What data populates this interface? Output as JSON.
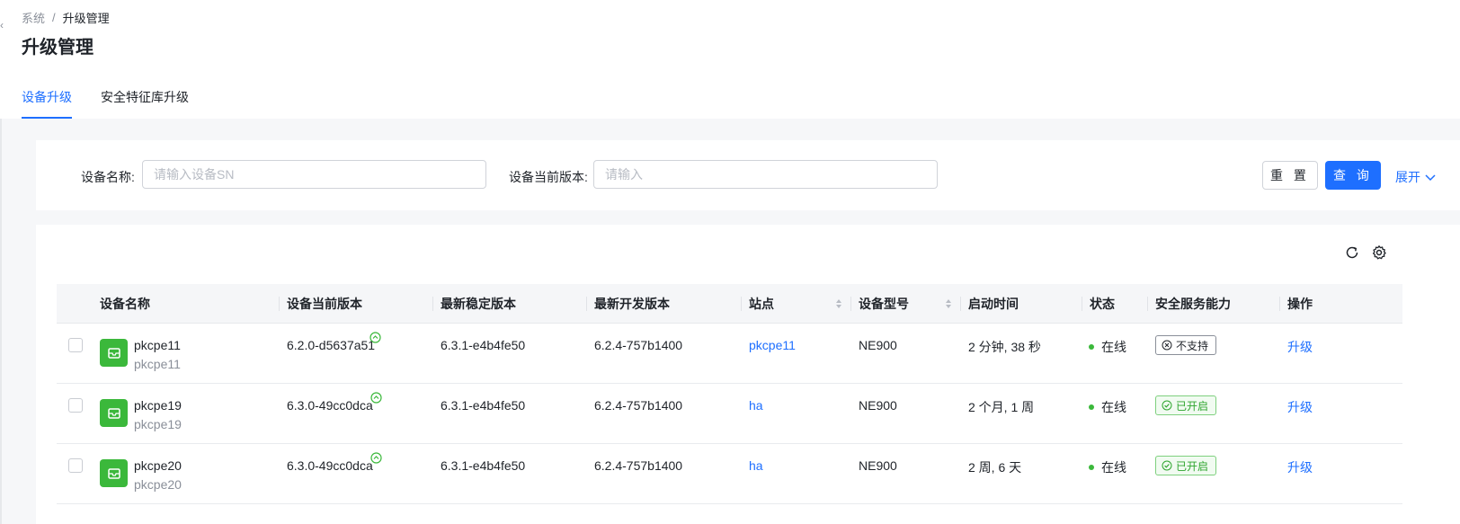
{
  "breadcrumb": {
    "root": "系统",
    "separator": "/",
    "current": "升级管理"
  },
  "page_title": "升级管理",
  "tabs": [
    {
      "label": "设备升级",
      "active": true
    },
    {
      "label": "安全特征库升级",
      "active": false
    }
  ],
  "search": {
    "device_name_label": "设备名称:",
    "device_name_placeholder": "请输入设备SN",
    "version_label": "设备当前版本:",
    "version_placeholder": "请输入",
    "reset_label": "重 置",
    "query_label": "查 询",
    "expand_label": "展开"
  },
  "table": {
    "columns": [
      "设备名称",
      "设备当前版本",
      "最新稳定版本",
      "最新开发版本",
      "站点",
      "设备型号",
      "启动时间",
      "状态",
      "安全服务能力",
      "操作"
    ],
    "rows": [
      {
        "name": "pkcpe11",
        "sub": "pkcpe11",
        "current_version": "6.2.0-d5637a51",
        "stable_version": "6.3.1-e4b4fe50",
        "dev_version": "6.2.4-757b1400",
        "site": "pkcpe11",
        "model": "NE900",
        "uptime": "2 分钟, 38 秒",
        "status": "在线",
        "security": "不支持",
        "action": "升级"
      },
      {
        "name": "pkcpe19",
        "sub": "pkcpe19",
        "current_version": "6.3.0-49cc0dca",
        "stable_version": "6.3.1-e4b4fe50",
        "dev_version": "6.2.4-757b1400",
        "site": "ha",
        "model": "NE900",
        "uptime": "2 个月, 1 周",
        "status": "在线",
        "security": "已开启",
        "action": "升级"
      },
      {
        "name": "pkcpe20",
        "sub": "pkcpe20",
        "current_version": "6.3.0-49cc0dca",
        "stable_version": "6.3.1-e4b4fe50",
        "dev_version": "6.2.4-757b1400",
        "site": "ha",
        "model": "NE900",
        "uptime": "2 周, 6 天",
        "status": "在线",
        "security": "已开启",
        "action": "升级"
      }
    ]
  },
  "colors": {
    "accent": "#1e6fff",
    "online": "#3bb83b",
    "enabled": "#2ea52e"
  },
  "icons": {
    "refresh": "refresh-icon",
    "settings": "gear-icon",
    "device": "device-box-icon",
    "upgrade_badge": "arrow-up-circle-icon"
  }
}
